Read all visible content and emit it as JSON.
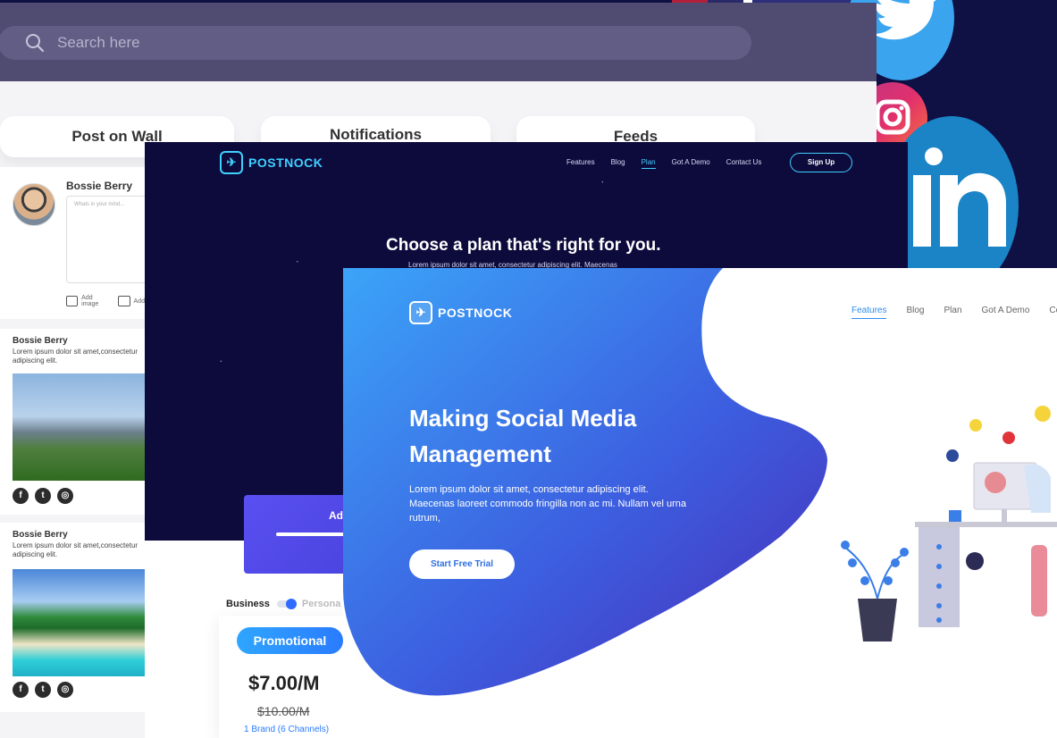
{
  "wall": {
    "search_placeholder": "Search here",
    "tabs": [
      "Post on Wall",
      "Notifications",
      "Feeds"
    ],
    "compose": {
      "name": "Bossie Berry",
      "placeholder": "Whats in your mind...",
      "add_image": "Add image",
      "add_video": "Add"
    },
    "posts": [
      {
        "name": "Bossie Berry",
        "text": "Lorem ipsum dolor sit amet,consectetur adipiscing elit."
      },
      {
        "name": "Bossie Berry",
        "text": "Lorem ipsum dolor sit amet,consectetur adipiscing elit."
      }
    ]
  },
  "pricing": {
    "logo": "POSTNOCK",
    "nav": [
      "Features",
      "Blog",
      "Plan",
      "Got A Demo",
      "Contact Us"
    ],
    "signup": "Sign Up",
    "headline": "Choose a plan that's right for you.",
    "subtext": "Lorem ipsum dolor sit amet, consectetur adipiscing elit. Maecenas",
    "add_card": "Ad",
    "toggle": {
      "business": "Business",
      "personal": "Persona"
    },
    "plan": {
      "badge": "Promotional",
      "price": "$7.00/M",
      "old_price": "$10.00/M",
      "brand": "1 Brand (6 Channels)"
    }
  },
  "hero": {
    "logo": "POSTNOCK",
    "nav": [
      "Features",
      "Blog",
      "Plan",
      "Got A Demo",
      "Co"
    ],
    "title": "Making Social Media Management",
    "body": "Lorem ipsum dolor sit amet, consectetur adipiscing elit. Maecenas laoreet commodo fringilla non ac mi. Nullam vel urna rutrum,",
    "cta": "Start Free Trial"
  },
  "colors": {
    "dark_navy": "#0d0b3c",
    "accent_cyan": "#3fd0ff",
    "hero_blue": "#2e8cf0",
    "hero_purple": "#4a2bb8"
  }
}
